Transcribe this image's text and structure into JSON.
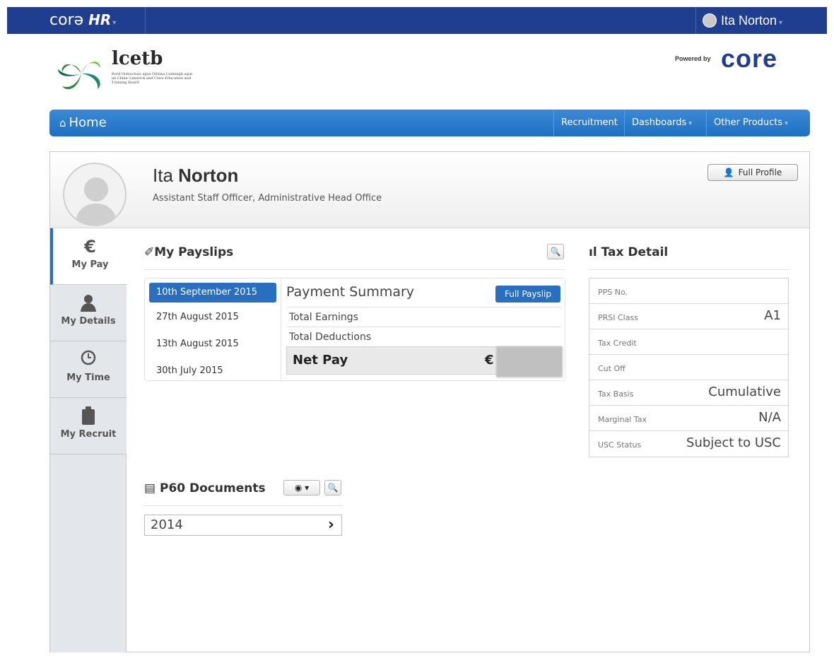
{
  "topbar": {
    "brand_text": "corə",
    "brand_hr": "HR",
    "user_name": "Ita Norton"
  },
  "org": {
    "name": "lcetb",
    "subtitle": "Bord Oideachais agus Oiliúna Luimnigh agus an Chláir Limerick and Clare Education and Training Board"
  },
  "powered": {
    "label": "Powered by",
    "logo": "core"
  },
  "nav": {
    "home": "Home",
    "recruitment": "Recruitment",
    "dashboards": "Dashboards",
    "other_products": "Other Products"
  },
  "profile": {
    "first_name": "Ita",
    "last_name": "Norton",
    "role": "Assistant Staff Officer, Administrative Head Office",
    "full_profile_label": "Full Profile"
  },
  "sidetabs": [
    {
      "label": "My Pay",
      "icon": "euro-icon"
    },
    {
      "label": "My Details",
      "icon": "person-icon"
    },
    {
      "label": "My Time",
      "icon": "clock-icon"
    },
    {
      "label": "My Recruit",
      "icon": "clipboard-icon"
    }
  ],
  "payslips": {
    "title": "My Payslips",
    "dates": [
      "10th September 2015",
      "27th August 2015",
      "13th August 2015",
      "30th July 2015"
    ],
    "summary_title": "Payment Summary",
    "full_payslip_label": "Full Payslip",
    "total_earnings_label": "Total Earnings",
    "total_deductions_label": "Total Deductions",
    "net_pay_label": "Net Pay",
    "currency_symbol": "€"
  },
  "tax": {
    "title": "Tax Detail",
    "rows": [
      {
        "label": "PPS No.",
        "value": ""
      },
      {
        "label": "PRSI Class",
        "value": "A1"
      },
      {
        "label": "Tax Credit",
        "value": ""
      },
      {
        "label": "Cut Off",
        "value": ""
      },
      {
        "label": "Tax Basis",
        "value": "Cumulative"
      },
      {
        "label": "Marginal Tax",
        "value": "N/A"
      },
      {
        "label": "USC Status",
        "value": "Subject to USC"
      }
    ]
  },
  "p60": {
    "title": "P60 Documents",
    "year": "2014"
  }
}
